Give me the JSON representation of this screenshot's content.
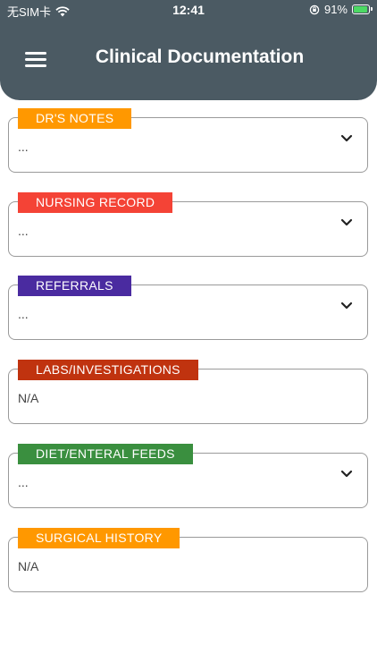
{
  "status_bar": {
    "carrier": "无SIM卡",
    "time": "12:41",
    "battery": "91%",
    "battery_level": 0.91
  },
  "header": {
    "title": "Clinical Documentation"
  },
  "sections": [
    {
      "label": "DR'S NOTES",
      "value": "...",
      "color": "#ff9800",
      "expandable": true
    },
    {
      "label": "NURSING RECORD",
      "value": "...",
      "color": "#f44336",
      "expandable": true
    },
    {
      "label": "REFERRALS",
      "value": "...",
      "color": "#4a2ba0",
      "expandable": true
    },
    {
      "label": "LABS/INVESTIGATIONS",
      "value": "N/A",
      "color": "#c0330f",
      "expandable": false
    },
    {
      "label": "DIET/ENTERAL FEEDS",
      "value": "...",
      "color": "#3a8f3f",
      "expandable": true
    },
    {
      "label": "SURGICAL HISTORY",
      "value": "N/A",
      "color": "#ff9800",
      "expandable": false
    }
  ]
}
